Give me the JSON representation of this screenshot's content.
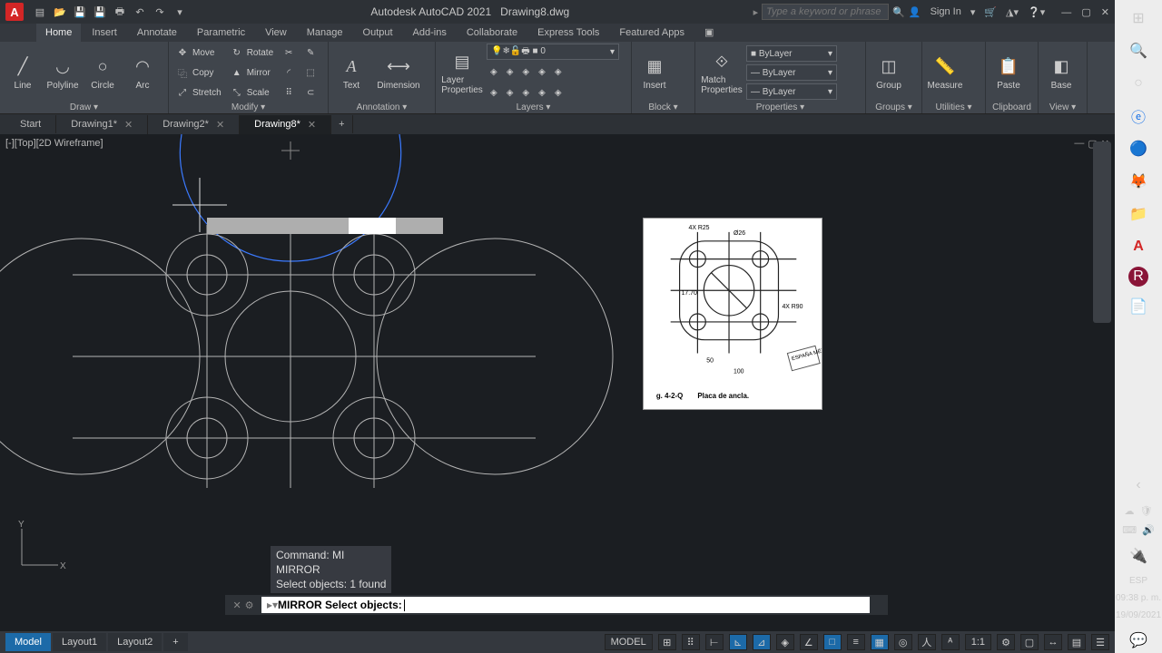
{
  "title": {
    "app": "Autodesk AutoCAD 2021",
    "file": "Drawing8.dwg"
  },
  "search": {
    "placeholder": "Type a keyword or phrase"
  },
  "signin": "Sign In",
  "tabs": [
    "Home",
    "Insert",
    "Annotate",
    "Parametric",
    "View",
    "Manage",
    "Output",
    "Add-ins",
    "Collaborate",
    "Express Tools",
    "Featured Apps"
  ],
  "draw": {
    "line": "Line",
    "polyline": "Polyline",
    "circle": "Circle",
    "arc": "Arc",
    "title": "Draw"
  },
  "modify": {
    "move": "Move",
    "copy": "Copy",
    "stretch": "Stretch",
    "rotate": "Rotate",
    "mirror": "Mirror",
    "scale": "Scale",
    "title": "Modify"
  },
  "annot": {
    "text": "Text",
    "dim": "Dimension",
    "title": "Annotation"
  },
  "layers": {
    "btn": "Layer\nProperties",
    "current": "0",
    "title": "Layers"
  },
  "block": {
    "insert": "Insert",
    "title": "Block"
  },
  "props": {
    "match": "Match\nProperties",
    "bylayer": "ByLayer",
    "title": "Properties"
  },
  "groups": {
    "group": "Group",
    "title": "Groups"
  },
  "util": {
    "measure": "Measure",
    "title": "Utilities"
  },
  "clip": {
    "paste": "Paste",
    "title": "Clipboard"
  },
  "base": {
    "base": "Base",
    "title": "View"
  },
  "filetabs": [
    {
      "label": "Start",
      "close": false
    },
    {
      "label": "Drawing1*",
      "close": true
    },
    {
      "label": "Drawing2*",
      "close": true
    },
    {
      "label": "Drawing8*",
      "close": true,
      "active": true
    }
  ],
  "viewlabel": "[-][Top][2D Wireframe]",
  "cmd": {
    "hist1": "Command: MI",
    "hist2": "MIRROR",
    "hist3": "Select objects: 1 found",
    "prompt": "MIRROR Select objects:"
  },
  "layout": {
    "model": "Model",
    "l1": "Layout1",
    "l2": "Layout2"
  },
  "status": {
    "model": "MODEL",
    "scale": "1:1"
  },
  "ref": {
    "caption": "Placa de ancla.",
    "fig": "g. 4-2-Q",
    "d1": "4X  R25",
    "d2": "Ø26",
    "d3": "17.70",
    "d4": "50",
    "d5": "100",
    "d6": "4X  R90",
    "stamp": "ESPAÑA\nMÉTRICO"
  },
  "tray": {
    "time": "09:38 p. m.",
    "date": "19/09/2021",
    "lang": "ESP"
  }
}
